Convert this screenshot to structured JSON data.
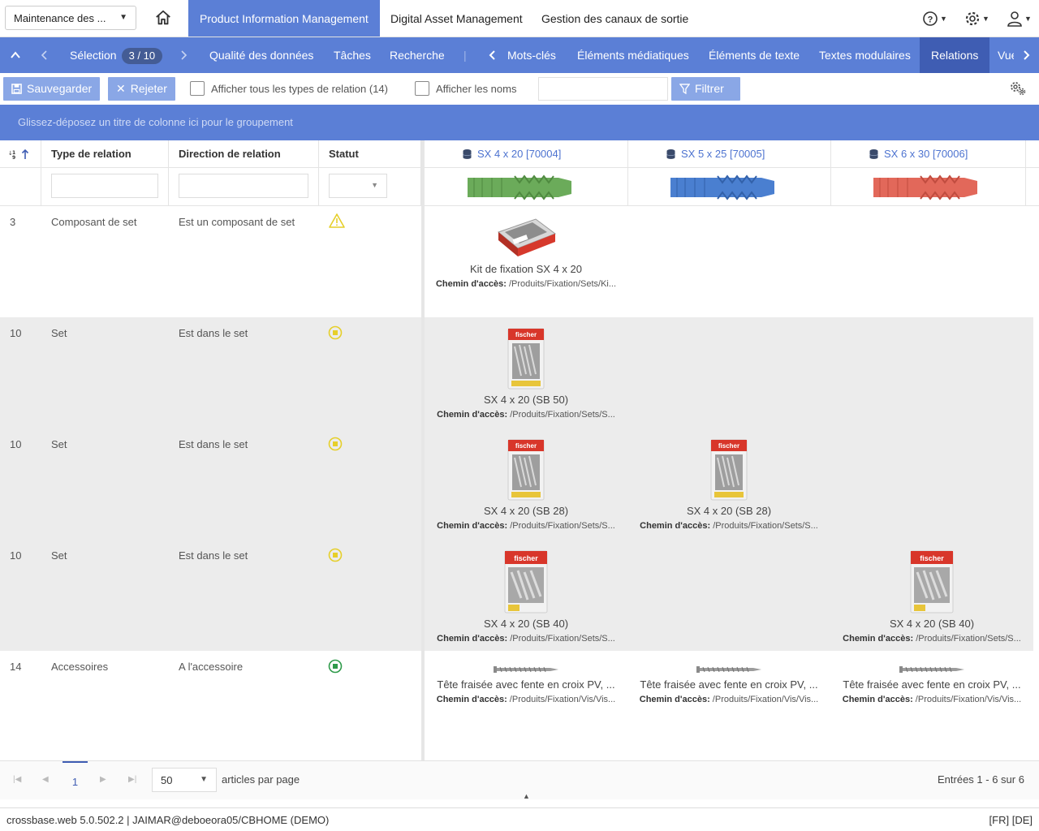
{
  "topbar": {
    "module_select": "Maintenance des ...",
    "tabs": [
      {
        "label": "Product Information Management",
        "active": true
      },
      {
        "label": "Digital Asset Management",
        "active": false
      },
      {
        "label": "Gestion des canaux de sortie",
        "active": false
      }
    ],
    "icons": [
      "help-icon",
      "settings-icon",
      "user-icon"
    ]
  },
  "nav": {
    "selection_label": "Sélection",
    "selection_badge": "3 / 10",
    "items": [
      "Qualité des données",
      "Tâches",
      "Recherche",
      "Mots-clés",
      "Éléments médiatiques",
      "Éléments de texte",
      "Textes modulaires",
      "Relations",
      "Vue"
    ],
    "active": "Relations"
  },
  "toolbar": {
    "save_label": "Sauvegarder",
    "reject_label": "Rejeter",
    "show_all_types": "Afficher tous les types de relation (14)",
    "show_names": "Afficher les noms",
    "filter_label": "Filtrer"
  },
  "groupbar": "Glissez-déposez un titre de colonne ici pour le groupement",
  "grid": {
    "columns": [
      "Type de relation",
      "Direction de relation",
      "Statut"
    ],
    "products": [
      {
        "label": "SX 4 x 20 [70004]",
        "color": "#6bab5a"
      },
      {
        "label": "SX 5 x 25 [70005]",
        "color": "#4a7fd0"
      },
      {
        "label": "SX 6 x 30 [70006]",
        "color": "#e2685a"
      }
    ],
    "path_label": "Chemin d'accès:",
    "rows": [
      {
        "num": "3",
        "type": "Composant de set",
        "direction": "Est un composant de set",
        "status": "warning",
        "items": [
          {
            "name": "Kit de fixation SX 4 x 20",
            "path": "/Produits/Fixation/Sets/Ki...",
            "col": 0,
            "img": "kit"
          }
        ]
      },
      {
        "num": "10",
        "type": "Set",
        "direction": "Est dans le set",
        "status": "pending",
        "items": [
          {
            "name": "SX 4 x 20 (SB 50)",
            "path": "/Produits/Fixation/Sets/S...",
            "col": 0,
            "img": "pack"
          }
        ]
      },
      {
        "num": "10",
        "type": "Set",
        "direction": "Est dans le set",
        "status": "pending",
        "items": [
          {
            "name": "SX 4 x 20 (SB 28)",
            "path": "/Produits/Fixation/Sets/S...",
            "col": 0,
            "img": "pack"
          },
          {
            "name": "SX 4 x 20 (SB 28)",
            "path": "/Produits/Fixation/Sets/S...",
            "col": 1,
            "img": "pack"
          }
        ]
      },
      {
        "num": "10",
        "type": "Set",
        "direction": "Est dans le set",
        "status": "pending",
        "items": [
          {
            "name": "SX 4 x 20 (SB 40)",
            "path": "/Produits/Fixation/Sets/S...",
            "col": 0,
            "img": "pack2"
          },
          {
            "name": "SX 4 x 20 (SB 40)",
            "path": "/Produits/Fixation/Sets/S...",
            "col": 2,
            "img": "pack2"
          }
        ]
      },
      {
        "num": "14",
        "type": "Accessoires",
        "direction": "A l'accessoire",
        "status": "ok",
        "items": [
          {
            "name": "Tête fraisée avec fente en croix PV, ...",
            "path": "/Produits/Fixation/Vis/Vis...",
            "col": 0,
            "img": "screw"
          },
          {
            "name": "Tête fraisée avec fente en croix PV, ...",
            "path": "/Produits/Fixation/Vis/Vis...",
            "col": 1,
            "img": "screw"
          },
          {
            "name": "Tête fraisée avec fente en croix PV, ...",
            "path": "/Produits/Fixation/Vis/Vis...",
            "col": 2,
            "img": "screw"
          }
        ]
      }
    ]
  },
  "pager": {
    "current_page": "1",
    "page_size": "50",
    "per_page_label": "articles par page",
    "entries": "Entrées 1 - 6 sur 6"
  },
  "footer": {
    "left": "crossbase.web 5.0.502.2 | JAIMAR@deboeora05/CBHOME (DEMO)",
    "right": "[FR] [DE]"
  }
}
